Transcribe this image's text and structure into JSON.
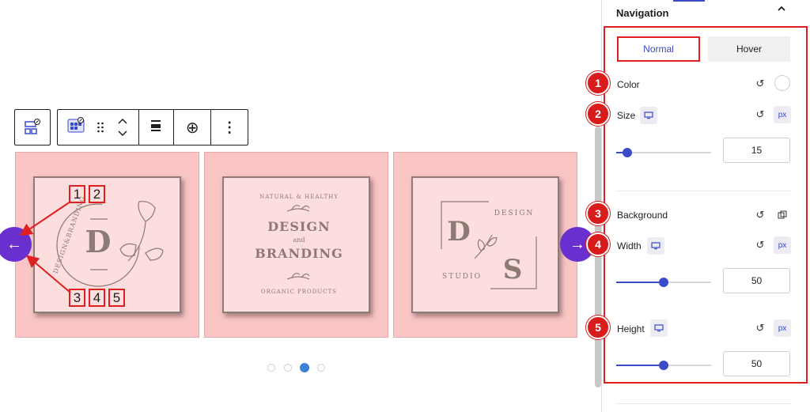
{
  "panel": {
    "section_title": "Navigation",
    "tabs": [
      {
        "label": "Normal",
        "active": true
      },
      {
        "label": "Hover",
        "active": false
      }
    ],
    "rows": {
      "color": {
        "badge": "1",
        "label": "Color"
      },
      "size": {
        "badge": "2",
        "label": "Size",
        "unit": "px",
        "value": "15",
        "slider_fraction": 0.12
      },
      "background": {
        "badge": "3",
        "label": "Background"
      },
      "width": {
        "badge": "4",
        "label": "Width",
        "unit": "px",
        "value": "50",
        "slider_fraction": 0.5
      },
      "height": {
        "badge": "5",
        "label": "Height",
        "unit": "px",
        "value": "50",
        "slider_fraction": 0.5
      }
    },
    "accent_color": "#3a4ac9",
    "highlight_color": "#e02020"
  },
  "canvas": {
    "slides": [
      {
        "logo": {
          "big_letter": "D",
          "ring_text": "DESIGN&BRANDING",
          "icon": "ginkgo-leaf-icon"
        }
      },
      {
        "logo": {
          "arc_top": "NATURAL & HEALTHY",
          "line1": "DESIGN",
          "connector": "and",
          "line2": "BRANDING",
          "arc_bottom": "ORGANIC PRODUCTS",
          "icon": "sprig-icon"
        }
      },
      {
        "logo": {
          "letter_a": "D",
          "letter_b": "S",
          "top_word": "DESIGN",
          "bottom_word": "STUDIO",
          "icon": "leaf-branch-icon"
        }
      }
    ],
    "prev_arrow": "←",
    "next_arrow": "→",
    "dots_count": 4,
    "active_dot": 3,
    "annotations": {
      "prev_group_top": [
        "1",
        "2"
      ],
      "prev_group_bottom": [
        "3",
        "4",
        "5"
      ]
    },
    "nav_color": "#6a2fcf",
    "slide_color": "#f9c6c5"
  },
  "toolbar": {
    "icons": [
      "layout-grid-icon",
      "block-type-icon",
      "drag-handle-icon",
      "move-up-down-icon",
      "align-icon",
      "add-icon",
      "more-options-icon"
    ],
    "more_glyph": "⋮",
    "add_glyph": "⊕"
  }
}
